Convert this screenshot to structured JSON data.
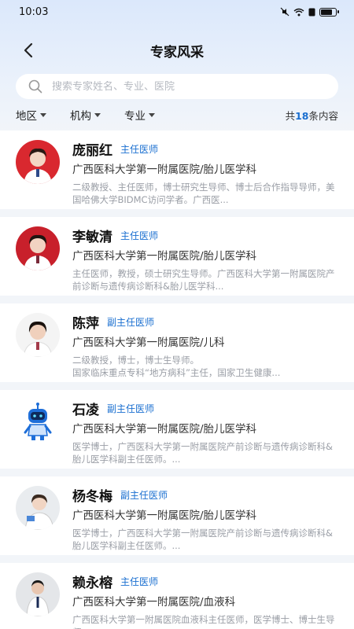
{
  "status": {
    "time": "10:03"
  },
  "nav": {
    "title": "专家风采"
  },
  "search": {
    "placeholder": "搜索专家姓名、专业、医院"
  },
  "filters": [
    {
      "label": "地区"
    },
    {
      "label": "机构"
    },
    {
      "label": "专业"
    }
  ],
  "count": {
    "prefix": "共",
    "num": "18",
    "suffix": "条内容"
  },
  "doctors": [
    {
      "name": "庞丽红",
      "title": "主任医师",
      "hospital": "广西医科大学第一附属医院/胎儿医学科",
      "bio": "二级教授、主任医师，博士研究生导师、博士后合作指导导师，美国哈佛大学BIDMC访问学者。广西医...",
      "avatar": "female-doctor-red-bg"
    },
    {
      "name": "李敏清",
      "title": "主任医师",
      "hospital": "广西医科大学第一附属医院/胎儿医学科",
      "bio": "主任医师，教授，硕士研究生导师。广西医科大学第一附属医院产前诊断与遗传病诊断科&胎儿医学科...",
      "avatar": "female-doctor-red-bg"
    },
    {
      "name": "陈萍",
      "title": "副主任医师",
      "hospital": "广西医科大学第一附属医院/儿科",
      "bio": "二级教授，博士，博士生导师。\n国家临床重点专科“地方病科”主任，国家卫生健康...",
      "avatar": "female-doctor-white-bg"
    },
    {
      "name": "石凌",
      "title": "副主任医师",
      "hospital": "广西医科大学第一附属医院/胎儿医学科",
      "bio": "医学博士，广西医科大学第一附属医院产前诊断与遗传病诊断科&胎儿医学科副主任医师。...",
      "avatar": "robot-icon"
    },
    {
      "name": "杨冬梅",
      "title": "副主任医师",
      "hospital": "广西医科大学第一附属医院/胎儿医学科",
      "bio": "医学博士，广西医科大学第一附属医院产前诊断与遗传病诊断科&胎儿医学科副主任医师。...",
      "avatar": "female-doctor-grey-bg"
    },
    {
      "name": "赖永榕",
      "title": "主任医师",
      "hospital": "广西医科大学第一附属医院/血液科",
      "bio": "广西医科大学第一附属医院血液科主任医师，医学博士、博士生导师。",
      "avatar": "male-doctor-grey-bg"
    }
  ],
  "colors": {
    "accent": "#1a6fd0",
    "background": "#f2f5f9"
  }
}
